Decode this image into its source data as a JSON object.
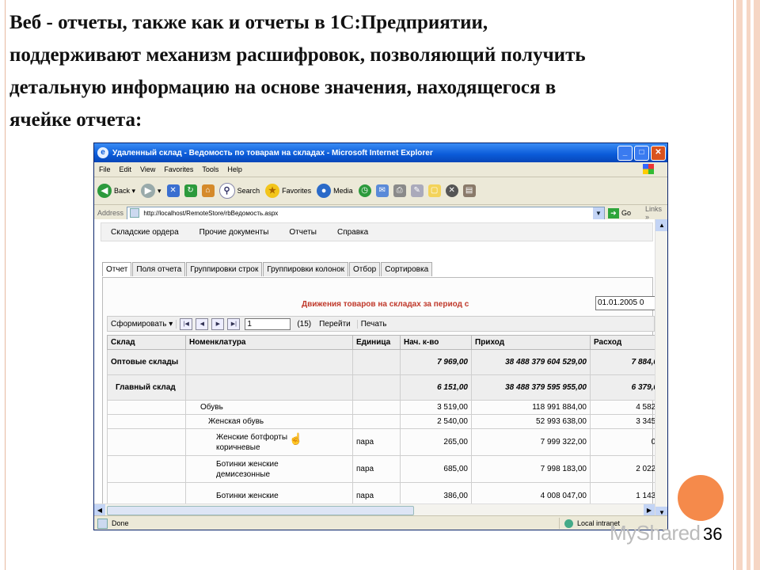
{
  "slide": {
    "heading": "Веб - отчеты, также как и отчеты в 1С:Предприятии,\nподдерживают механизм расшифровок, позволяющий получить\nдетальную информацию на основе значения, находящегося в\nячейке отчета:",
    "page_number": "36",
    "watermark": "MyShared",
    "accent_color": "#f58a4b"
  },
  "browser": {
    "title": "Удаленный склад - Ведомость по товарам на складах - Microsoft Internet Explorer",
    "menu": [
      "File",
      "Edit",
      "View",
      "Favorites",
      "Tools",
      "Help"
    ],
    "toolbar": {
      "back": "Back",
      "search": "Search",
      "favorites": "Favorites",
      "media": "Media"
    },
    "address": {
      "label": "Address",
      "url": "http://localhost/RemoteStore/rbВедомость.aspx",
      "go": "Go",
      "links": "Links"
    },
    "status": {
      "done": "Done",
      "zone": "Local intranet"
    }
  },
  "app": {
    "menu": [
      "Складские ордера",
      "Прочие документы",
      "Отчеты",
      "Справка"
    ],
    "tabs": [
      "Отчет",
      "Поля отчета",
      "Группировки строк",
      "Группировки колонок",
      "Отбор",
      "Сортировка"
    ],
    "report_title": "Движения товаров на складах за период с",
    "date_from": "01.01.2005 0",
    "nav": {
      "generate": "Сформировать",
      "page": "1",
      "total": "(15)",
      "go": "Перейти",
      "print": "Печать"
    },
    "columns": [
      "Склад",
      "Номенклатура",
      "Единица",
      "Нач. к-во",
      "Приход",
      "Расход"
    ],
    "rows": [
      {
        "sklad": "Оптовые склады",
        "nom": "",
        "unit": "",
        "start": "7 969,00",
        "prihod": "38 488 379 604 529,00",
        "rashod": "7 884,0",
        "kind": "grp1"
      },
      {
        "sklad": "Главный склад",
        "nom": "",
        "unit": "",
        "start": "6 151,00",
        "prihod": "38 488 379 595 955,00",
        "rashod": "6 379,0",
        "kind": "grp2"
      },
      {
        "sklad": "",
        "nom": "Обувь",
        "unit": "",
        "start": "3 519,00",
        "prihod": "118 991 884,00",
        "rashod": "4 582,",
        "kind": "lvl1"
      },
      {
        "sklad": "",
        "nom": "Женская обувь",
        "unit": "",
        "start": "2 540,00",
        "prihod": "52 993 638,00",
        "rashod": "3 345,",
        "kind": "lvl2"
      },
      {
        "sklad": "",
        "nom": "Женские ботфорты коричневые",
        "unit": "пара",
        "start": "265,00",
        "prihod": "7 999 322,00",
        "rashod": "0,",
        "kind": "item"
      },
      {
        "sklad": "",
        "nom": "Ботинки женские демисезонные",
        "unit": "пара",
        "start": "685,00",
        "prihod": "7 998 183,00",
        "rashod": "2 022,",
        "kind": "item"
      },
      {
        "sklad": "",
        "nom": "Ботинки женские",
        "unit": "пара",
        "start": "386,00",
        "prihod": "4 008 047,00",
        "rashod": "1 143,",
        "kind": "item"
      }
    ]
  }
}
